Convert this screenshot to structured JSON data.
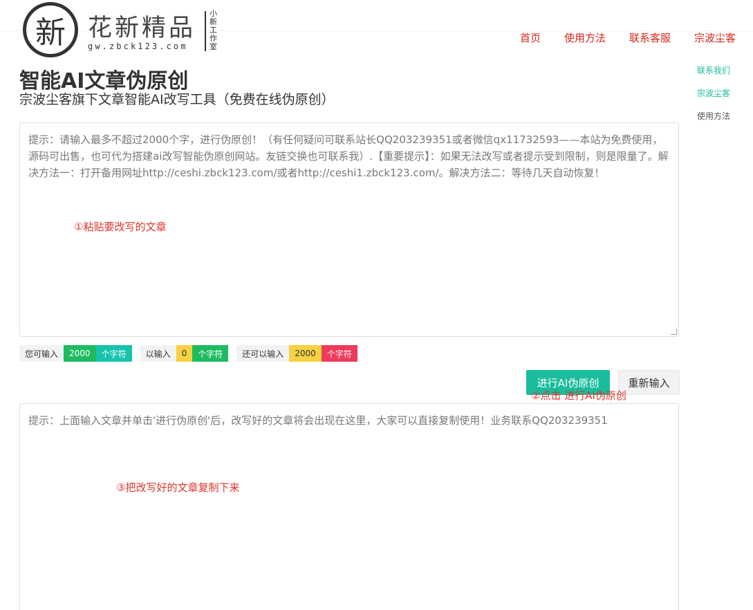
{
  "header": {
    "logo_char": "新",
    "logo_title": "花新精品",
    "logo_url": "gw.zbck123.com",
    "logo_vertical": "小新工作室",
    "nav": [
      "首页",
      "使用方法",
      "联系客服",
      "宗波尘客"
    ]
  },
  "side_links": [
    "联系我们",
    "宗波尘客",
    "使用方法"
  ],
  "page_title": "智能AI文章伪原创",
  "subtitle": "宗波尘客旗下文章智能AI改写工具（免费在线伪原创）",
  "input_area": {
    "placeholder": "提示：请输入最多不超过2000个字，进行伪原创！（有任何疑问可联系站长QQ203239351或者微信qx11732593——本站为免费使用，源码可出售，也可代为搭建ai改写智能伪原创网站。友链交换也可联系我）.【重要提示】：如果无法改写或者提示受到限制，则是限量了。解决方法一：打开备用网址http://ceshi.zbck123.com/或者http://ceshi1.zbck123.com/。解决方法二：等待几天自动恢复！",
    "annotation": "①粘贴要改写的文章"
  },
  "counters": [
    {
      "label": "您可输入",
      "value": "2000",
      "unit": "个字符",
      "value_color": "#1fbb61",
      "unit_color": "#17c3ae"
    },
    {
      "label": "以输入",
      "value": "0",
      "unit": "个字符",
      "value_color": "#f6d142",
      "unit_color": "#1fbb61"
    },
    {
      "label": "还可以输入",
      "value": "2000",
      "unit": "个字符",
      "value_color": "#f6d142",
      "unit_color": "#ee3a5b"
    }
  ],
  "buttons": {
    "submit_label": "进行AI伪原创",
    "reset_label": "重新输入",
    "submit_annotation": "②点击 进行AI伪原创"
  },
  "output_area": {
    "placeholder": "提示：上面输入文章并单击'进行伪原创'后，改写好的文章将会出现在这里，大家可以直接复制使用！业务联系QQ203239351",
    "annotation": "③把改写好的文章复制下来"
  },
  "colors": {
    "accent": "#1abc9c",
    "nav": "#d9261c",
    "annotation": "#e0342a"
  }
}
